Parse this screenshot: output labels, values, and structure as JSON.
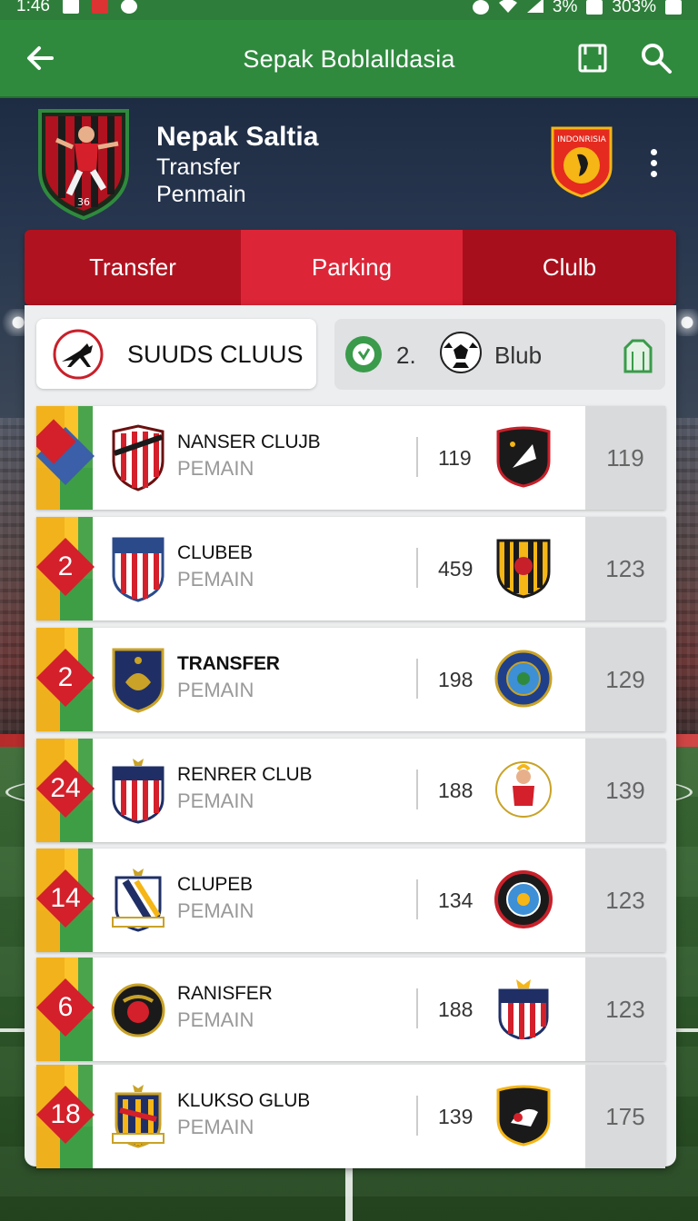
{
  "status_bar": {
    "time": "1:46",
    "battery_text": "3%",
    "battery_pct_text": "303%"
  },
  "app_bar": {
    "title": "Sepak Boblalldasia"
  },
  "header": {
    "name": "Nepak Saltia",
    "line1": "Transfer",
    "line2": "Penmain",
    "badge_text": "INDONRISIA",
    "player_number": "36"
  },
  "tabs": [
    {
      "label": "Transfer",
      "active": false
    },
    {
      "label": "Parking",
      "active": true
    },
    {
      "label": "Clulb",
      "active": false
    }
  ],
  "filters": {
    "left_label": "SUUDS CLUUS",
    "right_number": "2.",
    "right_label": "Blub"
  },
  "clubs": [
    {
      "rank": "",
      "name": "NANSER CLUJB",
      "sub": "PEMAIN",
      "value": "119",
      "score": "119"
    },
    {
      "rank": "2",
      "name": "CLUBEB",
      "sub": "PEMAIN",
      "value": "459",
      "score": "123"
    },
    {
      "rank": "2",
      "name": "TRANSFER",
      "sub": "PEMAIN",
      "value": "198",
      "score": "129"
    },
    {
      "rank": "24",
      "name": "RENRER CLUB",
      "sub": "PEMAIN",
      "value": "188",
      "score": "139"
    },
    {
      "rank": "14",
      "name": "CLUPEB",
      "sub": "PEMAIN",
      "value": "134",
      "score": "123"
    },
    {
      "rank": "6",
      "name": "RANISFER",
      "sub": "PEMAIN",
      "value": "188",
      "score": "123"
    },
    {
      "rank": "18",
      "name": "KLUKSO GLUB",
      "sub": "PEMAIN",
      "value": "139",
      "score": "175"
    }
  ],
  "colors": {
    "app_bar": "#2f8a3e",
    "tab_red": "#b1121f",
    "tab_active": "#dc2638",
    "rank_red": "#d3202b",
    "flag_yellow": "#f1b21c",
    "flag_green": "#4aa44b"
  },
  "icons": {
    "back": "arrow-left-icon",
    "bookmark": "bookmark-icon",
    "search": "search-icon",
    "more": "more-vert-icon",
    "filter_left": "horse-icon",
    "check": "check-circle-icon",
    "ball": "soccer-ball-icon",
    "kit": "jersey-icon"
  }
}
